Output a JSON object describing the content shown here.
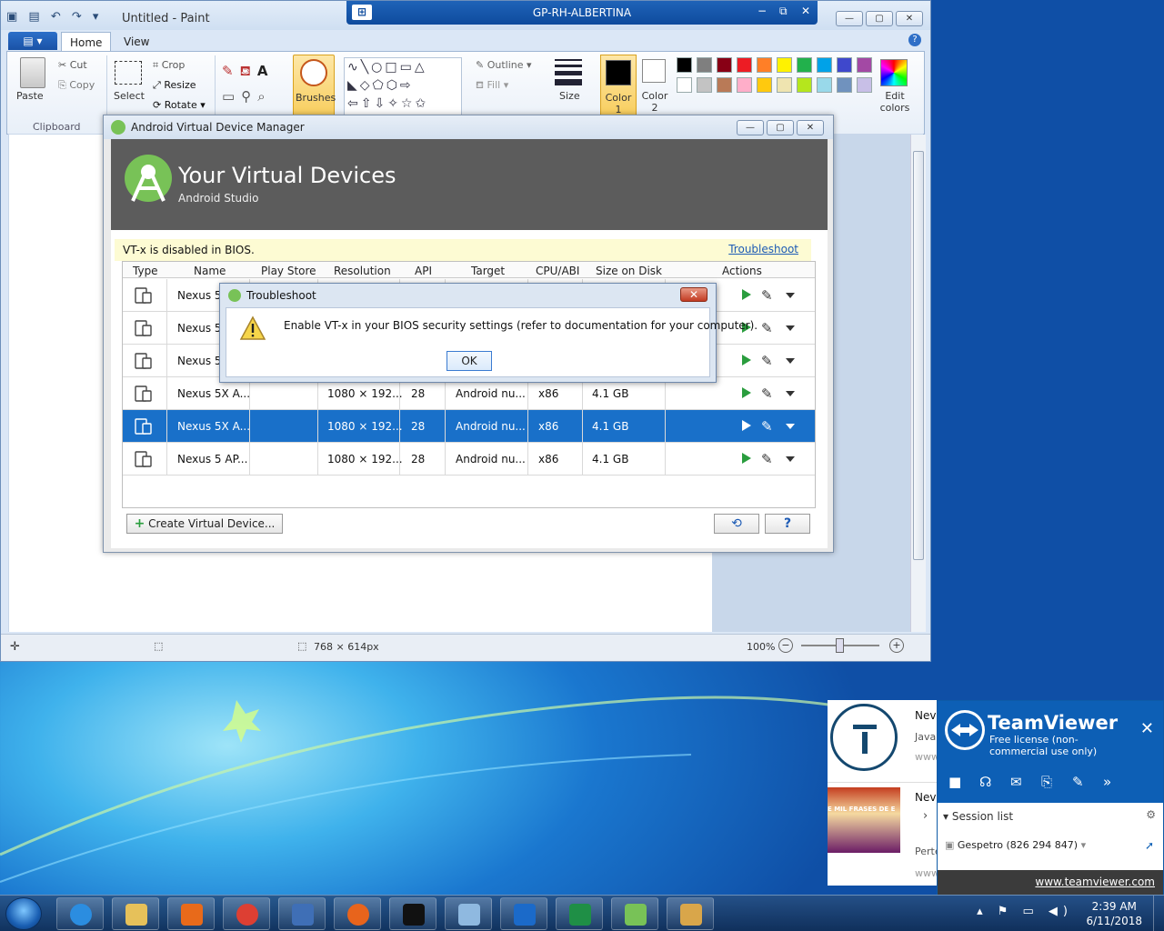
{
  "paint": {
    "title": "Untitled - Paint",
    "menu_label": "",
    "tabs": [
      "Home",
      "View"
    ],
    "clipboard": {
      "paste": "Paste",
      "cut": "Cut",
      "copy": "Copy",
      "group": "Clipboard"
    },
    "image": {
      "select": "Select",
      "crop": "Crop",
      "resize": "Resize",
      "rotate": "Rotate"
    },
    "brushes": "Brushes",
    "outline": "Outline",
    "fill": "Fill",
    "size": "Size",
    "color1": "Color 1",
    "color2": "Color 2",
    "edit_colors": "Edit colors",
    "palette_top": [
      "#000000",
      "#7f7f7f",
      "#880015",
      "#ed1c24",
      "#ff7f27",
      "#fff200",
      "#22b14c",
      "#00a2e8",
      "#3f48cc",
      "#a349a4"
    ],
    "palette_bottom": [
      "#ffffff",
      "#c3c3c3",
      "#b97a57",
      "#ffaec9",
      "#ffc90e",
      "#efe4b0",
      "#b5e61d",
      "#99d9ea",
      "#7092be",
      "#c8bfe7"
    ],
    "status": {
      "dimensions": "768 × 614px",
      "zoom": "100%"
    }
  },
  "remote_bar": {
    "title": "GP-RH-ALBERTINA"
  },
  "avd": {
    "window_title": "Android Virtual Device Manager",
    "heading": "Your Virtual Devices",
    "subheading": "Android Studio",
    "warning": "VT-x is disabled in BIOS.",
    "troubleshoot_link": "Troubleshoot",
    "columns": [
      "Type",
      "Name",
      "Play Store",
      "Resolution",
      "API",
      "Target",
      "CPU/ABI",
      "Size on Disk",
      "Actions"
    ],
    "rows": [
      {
        "name": "Nexus 5X",
        "resolution": "",
        "api": "",
        "target": "",
        "cpu": "",
        "size": "",
        "selected": false
      },
      {
        "name": "Nexus 5X",
        "resolution": "",
        "api": "",
        "target": "",
        "cpu": "",
        "size": "",
        "selected": false
      },
      {
        "name": "Nexus 5X",
        "resolution": "",
        "api": "",
        "target": "",
        "cpu": "",
        "size": "",
        "selected": false
      },
      {
        "name": "Nexus 5X A...",
        "resolution": "1080 × 192...",
        "api": "28",
        "target": "Android nu...",
        "cpu": "x86",
        "size": "4.1 GB",
        "selected": false
      },
      {
        "name": "Nexus 5X A...",
        "resolution": "1080 × 192...",
        "api": "28",
        "target": "Android nu...",
        "cpu": "x86",
        "size": "4.1 GB",
        "selected": true
      },
      {
        "name": "Nexus 5 AP...",
        "resolution": "1080 × 192...",
        "api": "28",
        "target": "Android nu...",
        "cpu": "x86",
        "size": "4.1 GB",
        "selected": false
      }
    ],
    "create_button": "Create Virtual Device...",
    "help_button": "?"
  },
  "dialog": {
    "title": "Troubleshoot",
    "message": "Enable VT-x in your BIOS security settings (refer to documentation for your computer).",
    "ok": "OK"
  },
  "teamviewer": {
    "name": "TeamViewer",
    "license": "Free license (non-commercial use only)",
    "session_list": "Session list",
    "session": "Gespetro (826 294 847)",
    "link": "www.teamviewer.com",
    "feed": {
      "item1_title": "Nev",
      "item1_sub": "Java",
      "item1_url": "www",
      "item2_title": "Nev",
      "item2_sub": "Perte",
      "item2_url": "www",
      "item2_banner": "E MIL FRASES DE E"
    }
  },
  "taskbar": {
    "time": "2:39 AM",
    "date": "6/11/2018",
    "apps": [
      "internet-explorer",
      "file-explorer",
      "media-player",
      "chrome",
      "windows-server-manager",
      "firefox",
      "command-prompt",
      "notepad",
      "outlook",
      "excel",
      "android-studio",
      "paint"
    ]
  }
}
